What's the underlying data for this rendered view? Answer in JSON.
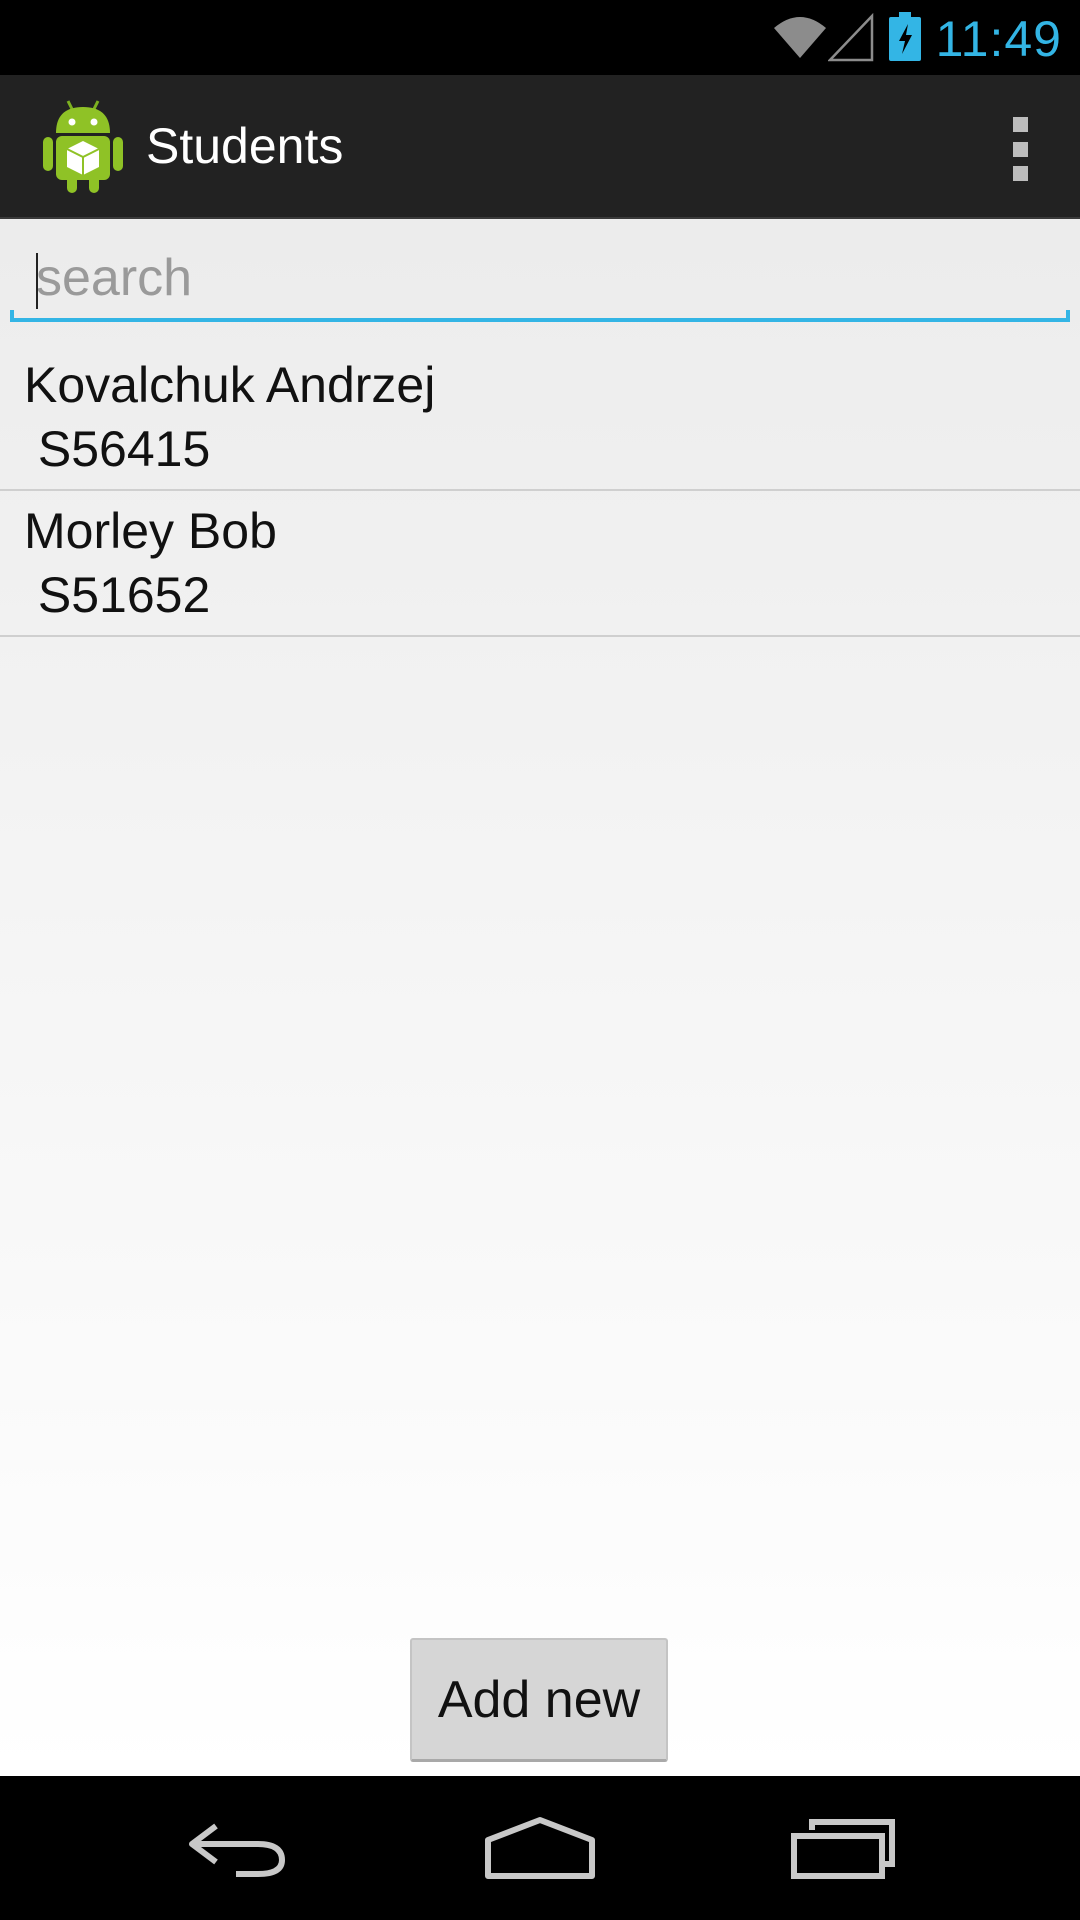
{
  "status_bar": {
    "time": "11:49",
    "icons": [
      "wifi-icon",
      "cell-signal-icon",
      "battery-charging-icon"
    ],
    "accent_color": "#33b5e5"
  },
  "action_bar": {
    "title": "Students",
    "app_icon": "android-app-icon",
    "overflow_icon": "overflow-menu-icon"
  },
  "search": {
    "placeholder": "search",
    "value": ""
  },
  "students": [
    {
      "name": "Kovalchuk Andrzej",
      "id": " S56415"
    },
    {
      "name": "Morley Bob",
      "id": " S51652"
    }
  ],
  "add_button": {
    "label": "Add new"
  },
  "nav_bar": {
    "icons": [
      "back-icon",
      "home-icon",
      "recent-apps-icon"
    ]
  }
}
